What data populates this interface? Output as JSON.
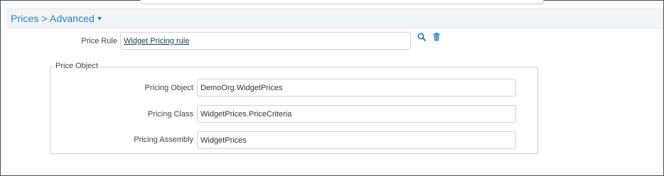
{
  "section": {
    "breadcrumb_root": "Prices",
    "breadcrumb_separator": ">",
    "breadcrumb_current": "Advanced"
  },
  "price_rule": {
    "label": "Price Rule",
    "value": "Widget Pricing rule",
    "search_icon": "search-icon",
    "delete_icon": "trash-icon"
  },
  "price_object": {
    "legend": "Price Object",
    "fields": [
      {
        "label": "Pricing Object",
        "value": "DemoOrg.WidgetPrices"
      },
      {
        "label": "Pricing Class",
        "value": "WidgetPrices.PriceCriteria"
      },
      {
        "label": "Pricing Assembly",
        "value": "WidgetPrices"
      }
    ]
  },
  "colors": {
    "accent": "#2a7fc1",
    "header_background": "#f1f4f8",
    "link": "#1f3b57"
  }
}
